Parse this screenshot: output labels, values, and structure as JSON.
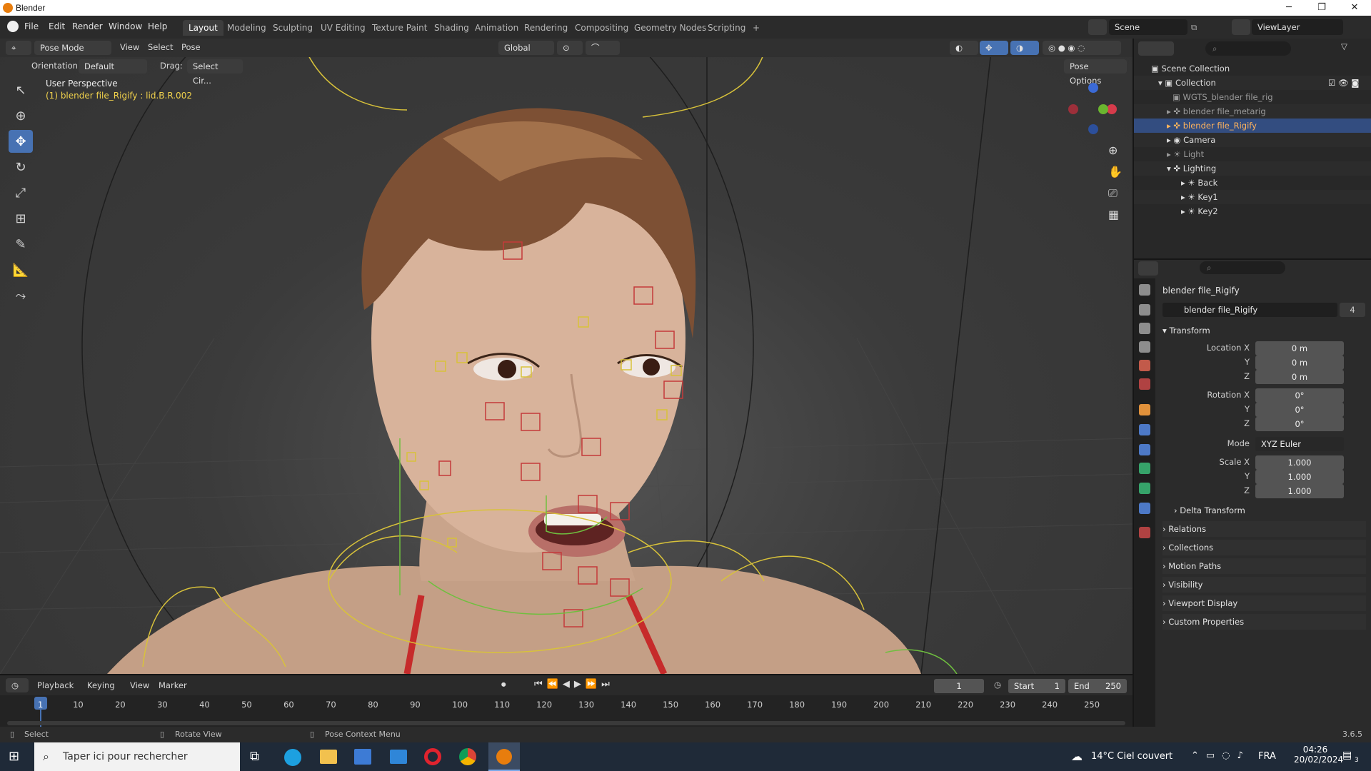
{
  "window": {
    "title": "Blender",
    "minimize": "─",
    "maximize": "❐",
    "close": "✕"
  },
  "menu": [
    "File",
    "Edit",
    "Render",
    "Window",
    "Help"
  ],
  "workspaces": [
    "Layout",
    "Modeling",
    "Sculpting",
    "UV Editing",
    "Texture Paint",
    "Shading",
    "Animation",
    "Rendering",
    "Compositing",
    "Geometry Nodes",
    "Scripting",
    "+"
  ],
  "scene": {
    "label": "Scene",
    "view_layer": "ViewLayer"
  },
  "viewport_header": {
    "mode": "Pose Mode",
    "view": "View",
    "select": "Select",
    "pose": "Pose",
    "transform": "Global",
    "orientation_label": "Orientation:",
    "orientation_value": "Default",
    "drag_label": "Drag:",
    "drag_value": "Select Cir...",
    "pose_options": "Pose Options"
  },
  "viewport_overlay": {
    "perspective": "User Perspective",
    "object_info": "(1) blender file_Rigify : lid.B.R.002"
  },
  "outliner": {
    "scene_collection": "Scene Collection",
    "items": [
      {
        "label": "Collection"
      },
      {
        "label": "WGTS_blender file_rig"
      },
      {
        "label": "blender file_metarig"
      },
      {
        "label": "blender file_Rigify"
      },
      {
        "label": "Camera"
      },
      {
        "label": "Light"
      },
      {
        "label": "Lighting"
      },
      {
        "label": "Back"
      },
      {
        "label": "Key1"
      },
      {
        "label": "Key2"
      }
    ]
  },
  "properties": {
    "object_name": "blender file_Rigify",
    "datablock": "blender file_Rigify",
    "users": "4",
    "transform_title": "Transform",
    "location": {
      "label_x": "Location X",
      "x": "0 m",
      "y": "0 m",
      "z": "0 m"
    },
    "rotation": {
      "label_x": "Rotation X",
      "x": "0°",
      "y": "0°",
      "z": "0°"
    },
    "mode_label": "Mode",
    "mode_value": "XYZ Euler",
    "scale": {
      "label_x": "Scale X",
      "x": "1.000",
      "y": "1.000",
      "z": "1.000"
    },
    "axis_y": "Y",
    "axis_z": "Z",
    "panels": [
      "Delta Transform",
      "Relations",
      "Collections",
      "Motion Paths",
      "Visibility",
      "Viewport Display",
      "Custom Properties"
    ]
  },
  "timeline": {
    "playback": "Playback",
    "keying": "Keying",
    "view": "View",
    "marker": "Marker",
    "current_frame": "1",
    "start_label": "Start",
    "start": "1",
    "end_label": "End",
    "end": "250",
    "ticks": [
      "1",
      "10",
      "20",
      "30",
      "40",
      "50",
      "60",
      "70",
      "80",
      "90",
      "100",
      "110",
      "120",
      "130",
      "140",
      "150",
      "160",
      "170",
      "180",
      "190",
      "200",
      "210",
      "220",
      "230",
      "240",
      "250"
    ]
  },
  "statusbar": {
    "select": "Select",
    "rotate": "Rotate View",
    "context": "Pose Context Menu",
    "version": "3.6.5"
  },
  "taskbar": {
    "search_placeholder": "Taper ici pour rechercher",
    "weather": "14°C  Ciel couvert",
    "lang": "FRA",
    "time": "04:26",
    "date": "20/02/2024",
    "notif": "3"
  },
  "colors": {
    "accent": "#4772b3",
    "selection": "#334d80",
    "rig_yellow": "#d8c23a",
    "rig_red": "#c43a3a",
    "rig_green": "#6fbf3f"
  }
}
